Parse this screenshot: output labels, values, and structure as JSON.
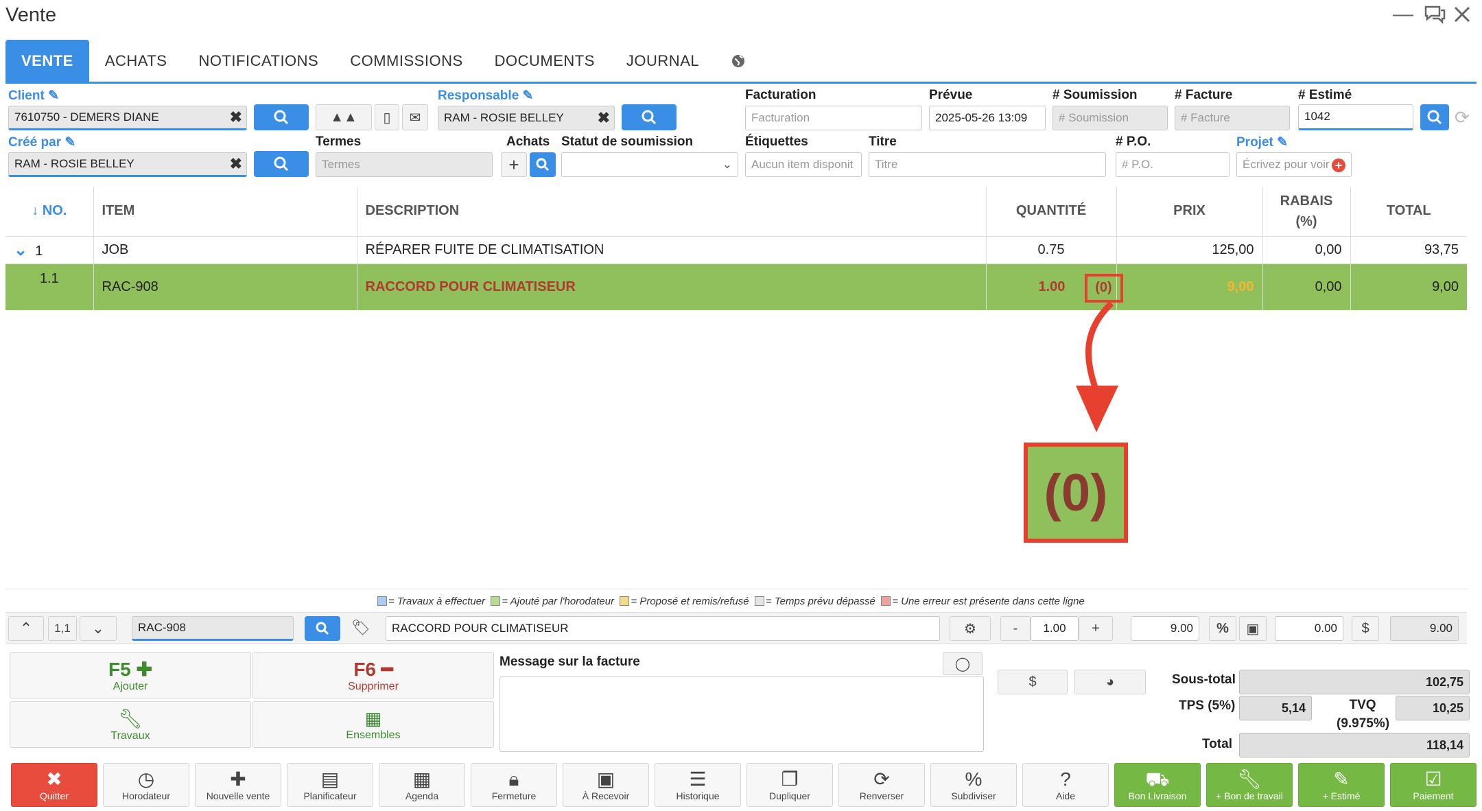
{
  "window": {
    "title": "Vente"
  },
  "tabs": [
    "VENTE",
    "ACHATS",
    "NOTIFICATIONS",
    "COMMISSIONS",
    "DOCUMENTS",
    "JOURNAL"
  ],
  "form": {
    "client_label": "Client",
    "client_value": "7610750 - DEMERS DIANE",
    "responsable_label": "Responsable",
    "responsable_value": "RAM - ROSIE BELLEY",
    "facturation_label": "Facturation",
    "facturation_placeholder": "Facturation",
    "prevue_label": "Prévue",
    "prevue_value": "2025-05-26 13:09",
    "soumission_label": "# Soumission",
    "soumission_placeholder": "# Soumission",
    "facture_label": "# Facture",
    "facture_placeholder": "# Facture",
    "estime_label": "# Estimé",
    "estime_value": "1042",
    "cree_par_label": "Créé par",
    "cree_par_value": "RAM - ROSIE BELLEY",
    "termes_label": "Termes",
    "termes_placeholder": "Termes",
    "achats_label": "Achats",
    "statut_label": "Statut de soumission",
    "statut_value": "",
    "etiquettes_label": "Étiquettes",
    "etiquettes_placeholder": "Aucun item disponit",
    "titre_label": "Titre",
    "titre_placeholder": "Titre",
    "po_label": "# P.O.",
    "po_placeholder": "# P.O.",
    "projet_label": "Projet",
    "projet_placeholder": "Écrivez pour voir"
  },
  "table": {
    "headers": {
      "no": "↓ NO.",
      "item": "ITEM",
      "description": "DESCRIPTION",
      "quantite": "QUANTITÉ",
      "prix": "PRIX",
      "rabais1": "RABAIS",
      "rabais2": "(%)",
      "total": "TOTAL"
    },
    "rows": [
      {
        "no": "1",
        "item": "JOB",
        "description": "RÉPARER FUITE DE CLIMATISATION",
        "quantite": "0.75",
        "prix": "125,00",
        "rabais": "0,00",
        "total": "93,75"
      },
      {
        "no": "1.1",
        "item": "RAC-908",
        "description": "RACCORD POUR CLIMATISEUR",
        "quantite": "1.00",
        "stock": "(0)",
        "prix": "9,00",
        "rabais": "0,00",
        "total": "9,00"
      }
    ]
  },
  "callout": {
    "text": "(0)"
  },
  "legend": [
    {
      "color": "#a9cdf0",
      "text": "= Travaux à effectuer"
    },
    {
      "color": "#b9dc95",
      "text": "= Ajouté par l'horodateur"
    },
    {
      "color": "#f5d98a",
      "text": "= Proposé et remis/refusé"
    },
    {
      "color": "#e4e4e4",
      "text": "= Temps prévu dépassé"
    },
    {
      "color": "#f0a0a0",
      "text": "= Une erreur est présente dans cette ligne"
    }
  ],
  "editbar": {
    "line": "1,1",
    "item": "RAC-908",
    "description": "RACCORD POUR CLIMATISEUR",
    "qty_minus": "-",
    "qty": "1.00",
    "qty_plus": "+",
    "price": "9.00",
    "pct": "%",
    "discount": "0.00",
    "dollar": "$",
    "total": "9.00"
  },
  "actions": {
    "f5_key": "F5",
    "f5_label": "Ajouter",
    "f6_key": "F6",
    "f6_label": "Supprimer",
    "travaux_label": "Travaux",
    "ensembles_label": "Ensembles"
  },
  "message": {
    "label": "Message sur la facture",
    "value": ""
  },
  "totals": {
    "sous_total_label": "Sous-total",
    "sous_total": "102,75",
    "tps_label": "TPS (5%)",
    "tps": "5,14",
    "tvq_label": "TVQ",
    "tvq_rate": "(9.975%)",
    "tvq": "10,25",
    "total_label": "Total",
    "total": "118,14",
    "dollar_btn": "$"
  },
  "toolbar": [
    "Quitter",
    "Horodateur",
    "Nouvelle vente",
    "Planificateur",
    "Agenda",
    "Fermeture",
    "À Recevoir",
    "Historique",
    "Dupliquer",
    "Renverser",
    "Subdiviser",
    "Aide",
    "Bon Livraison",
    "+ Bon de travail",
    "+ Estimé",
    "Paiement"
  ],
  "colors": {
    "accent": "#3a8ee6",
    "row_highlight": "#90c05c",
    "danger": "#e84c3d",
    "success": "#75b843",
    "callout_border": "#e8402f"
  }
}
